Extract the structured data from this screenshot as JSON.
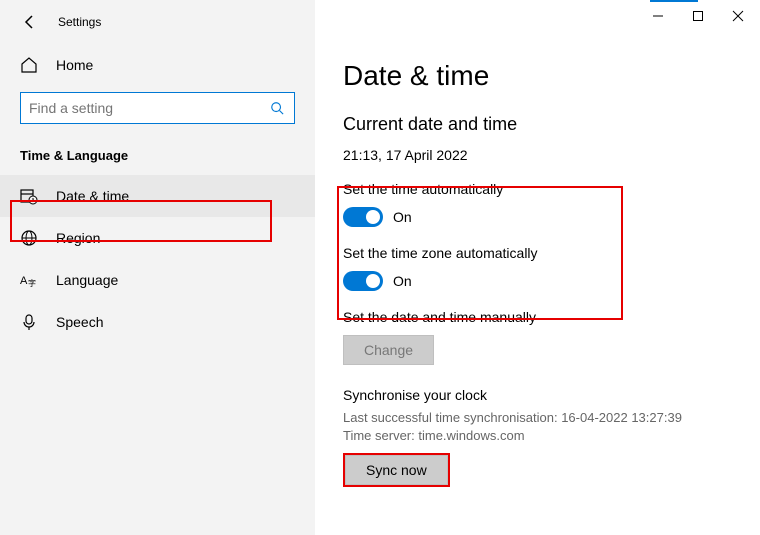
{
  "app_title": "Settings",
  "home_label": "Home",
  "search_placeholder": "Find a setting",
  "section_title": "Time & Language",
  "nav": {
    "date_time": "Date & time",
    "region": "Region",
    "language": "Language",
    "speech": "Speech"
  },
  "page": {
    "title": "Date & time",
    "subhead": "Current date and time",
    "current": "21:13, 17 April 2022",
    "auto_time_label": "Set the time automatically",
    "auto_time_state": "On",
    "auto_tz_label": "Set the time zone automatically",
    "auto_tz_state": "On",
    "manual_label": "Set the date and time manually",
    "change_btn": "Change",
    "sync_head": "Synchronise your clock",
    "sync_last": "Last successful time synchronisation: 16-04-2022 13:27:39",
    "sync_server": "Time server: time.windows.com",
    "sync_btn": "Sync now"
  }
}
